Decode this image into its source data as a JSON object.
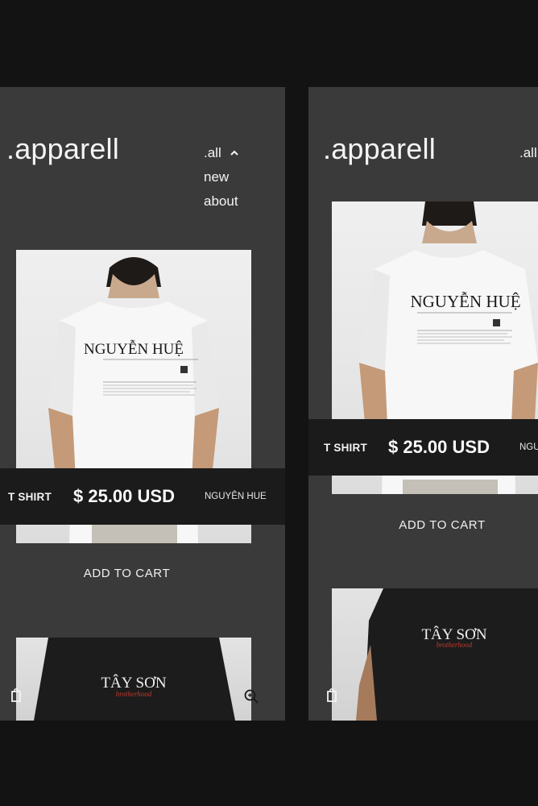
{
  "brand": ".apparell",
  "nav": {
    "all": ".all",
    "new": "new",
    "about": "about"
  },
  "product": {
    "name": "T SHIRT",
    "price": "$ 25.00 USD",
    "design": "NGUYÊN HUE",
    "design_short": "NGU",
    "cta": "ADD TO CART",
    "front_print": "NGUYỄN HUỆ",
    "next_print": "TÂY SƠN",
    "next_script": "brotherhood"
  },
  "icons": {
    "nav_toggle": "chevron-up-icon",
    "left_action": "shopping-bag-icon",
    "right_action": "zoom-in-icon"
  },
  "colors": {
    "page_bg": "#131313",
    "screen_bg": "#3a3a3a",
    "bar_bg": "#1b1b1b",
    "accent_red": "#c0392b"
  }
}
